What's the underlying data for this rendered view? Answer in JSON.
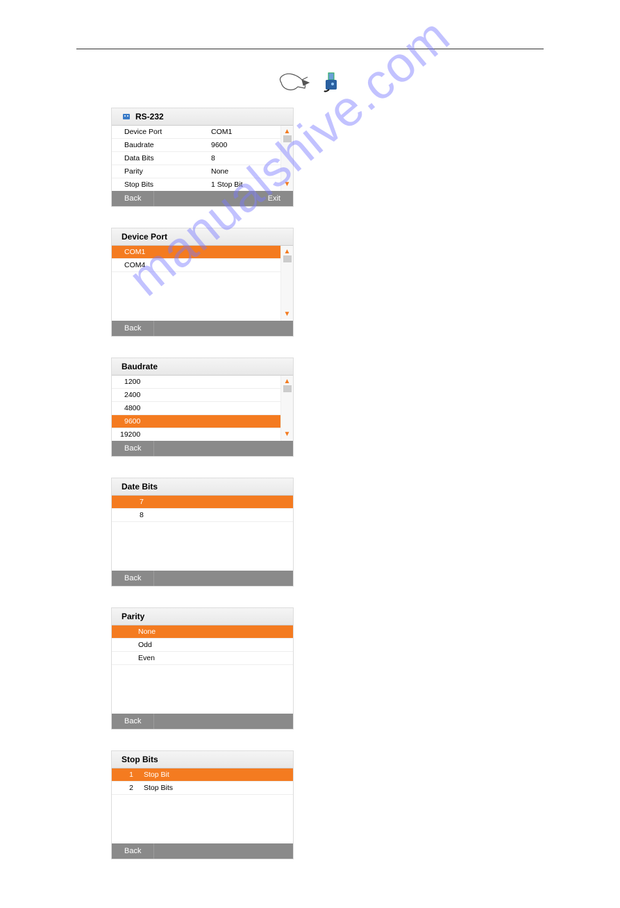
{
  "watermark": "manualshive.com",
  "panels": {
    "rs232": {
      "title": "RS-232",
      "rows": [
        {
          "label": "Device Port",
          "value": "COM1"
        },
        {
          "label": "Baudrate",
          "value": "9600"
        },
        {
          "label": "Data Bits",
          "value": "8"
        },
        {
          "label": "Parity",
          "value": "None"
        },
        {
          "label": "Stop Bits",
          "value": "1 Stop Bit"
        }
      ],
      "back": "Back",
      "exit": "Exit"
    },
    "deviceport": {
      "title": "Device Port",
      "rows": [
        {
          "label": "COM1",
          "selected": true
        },
        {
          "label": "COM4"
        }
      ],
      "back": "Back"
    },
    "baudrate": {
      "title": "Baudrate",
      "rows": [
        {
          "label": "1200"
        },
        {
          "label": "2400"
        },
        {
          "label": "4800"
        },
        {
          "label": "9600",
          "selected": true
        },
        {
          "label": "19200"
        }
      ],
      "back": "Back"
    },
    "databits": {
      "title": "Date Bits",
      "rows": [
        {
          "label": "7",
          "selected": true
        },
        {
          "label": "8"
        }
      ],
      "back": "Back"
    },
    "parity": {
      "title": "Parity",
      "rows": [
        {
          "label": "None",
          "selected": true
        },
        {
          "label": "Odd"
        },
        {
          "label": "Even"
        }
      ],
      "back": "Back"
    },
    "stopbits": {
      "title": "Stop Bits",
      "rows": [
        {
          "num": "1",
          "label": "Stop Bit",
          "selected": true
        },
        {
          "num": "2",
          "label": "Stop Bits"
        }
      ],
      "back": "Back"
    }
  }
}
